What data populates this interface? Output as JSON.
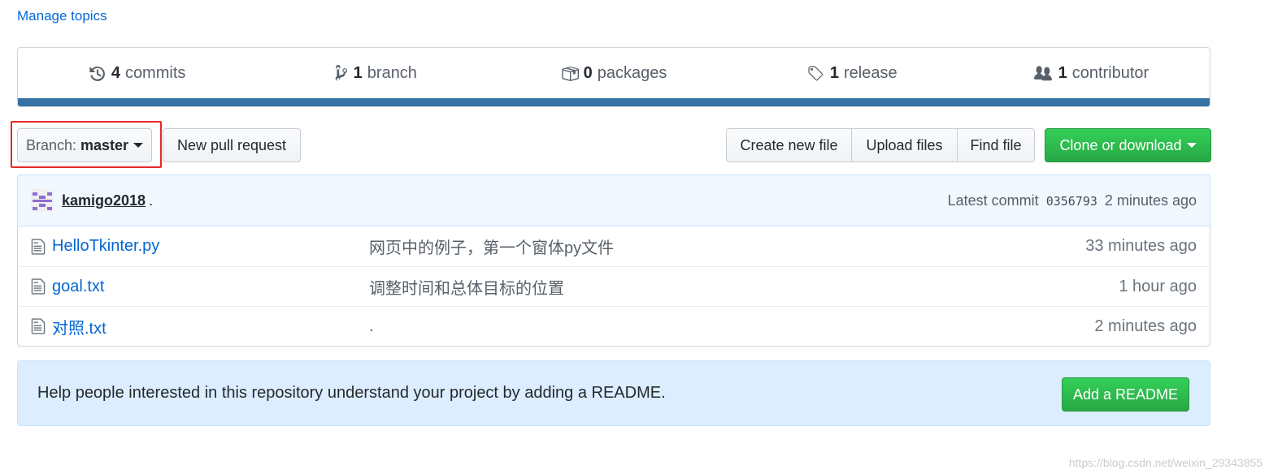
{
  "manage_topics": "Manage topics",
  "summary": {
    "commits": {
      "num": "4",
      "label": "commits",
      "icon": "history-icon"
    },
    "branches": {
      "num": "1",
      "label": "branch",
      "icon": "git-branch-icon"
    },
    "packages": {
      "num": "0",
      "label": "packages",
      "icon": "package-icon"
    },
    "releases": {
      "num": "1",
      "label": "release",
      "icon": "tag-icon"
    },
    "contributors": {
      "num": "1",
      "label": "contributor",
      "icon": "people-icon"
    },
    "language_color": "#3572a5"
  },
  "toolbar": {
    "branch_prefix": "Branch:",
    "branch_name": "master",
    "new_pull_request": "New pull request",
    "create_new_file": "Create new file",
    "upload_files": "Upload files",
    "find_file": "Find file",
    "clone_or_download": "Clone or download"
  },
  "commit": {
    "author": "kamigo2018",
    "message": ".",
    "latest_label": "Latest commit",
    "sha": "0356793",
    "age": "2 minutes ago"
  },
  "files": [
    {
      "name": "HelloTkinter.py",
      "message": "网页中的例子，第一个窗体py文件",
      "age": "33 minutes ago"
    },
    {
      "name": "goal.txt",
      "message": "调整时间和总体目标的位置",
      "age": "1 hour ago"
    },
    {
      "name": "对照.txt",
      "message": ".",
      "age": "2 minutes ago"
    }
  ],
  "readme": {
    "text": "Help people interested in this repository understand your project by adding a README.",
    "button": "Add a README"
  },
  "watermark": "https://blog.csdn.net/weixin_29343855",
  "colors": {
    "link": "#0366d6",
    "green_button": "#28a745",
    "highlight_border": "#e8272a",
    "readme_bg": "#dbedff",
    "commit_bg": "#f1f8ff"
  }
}
